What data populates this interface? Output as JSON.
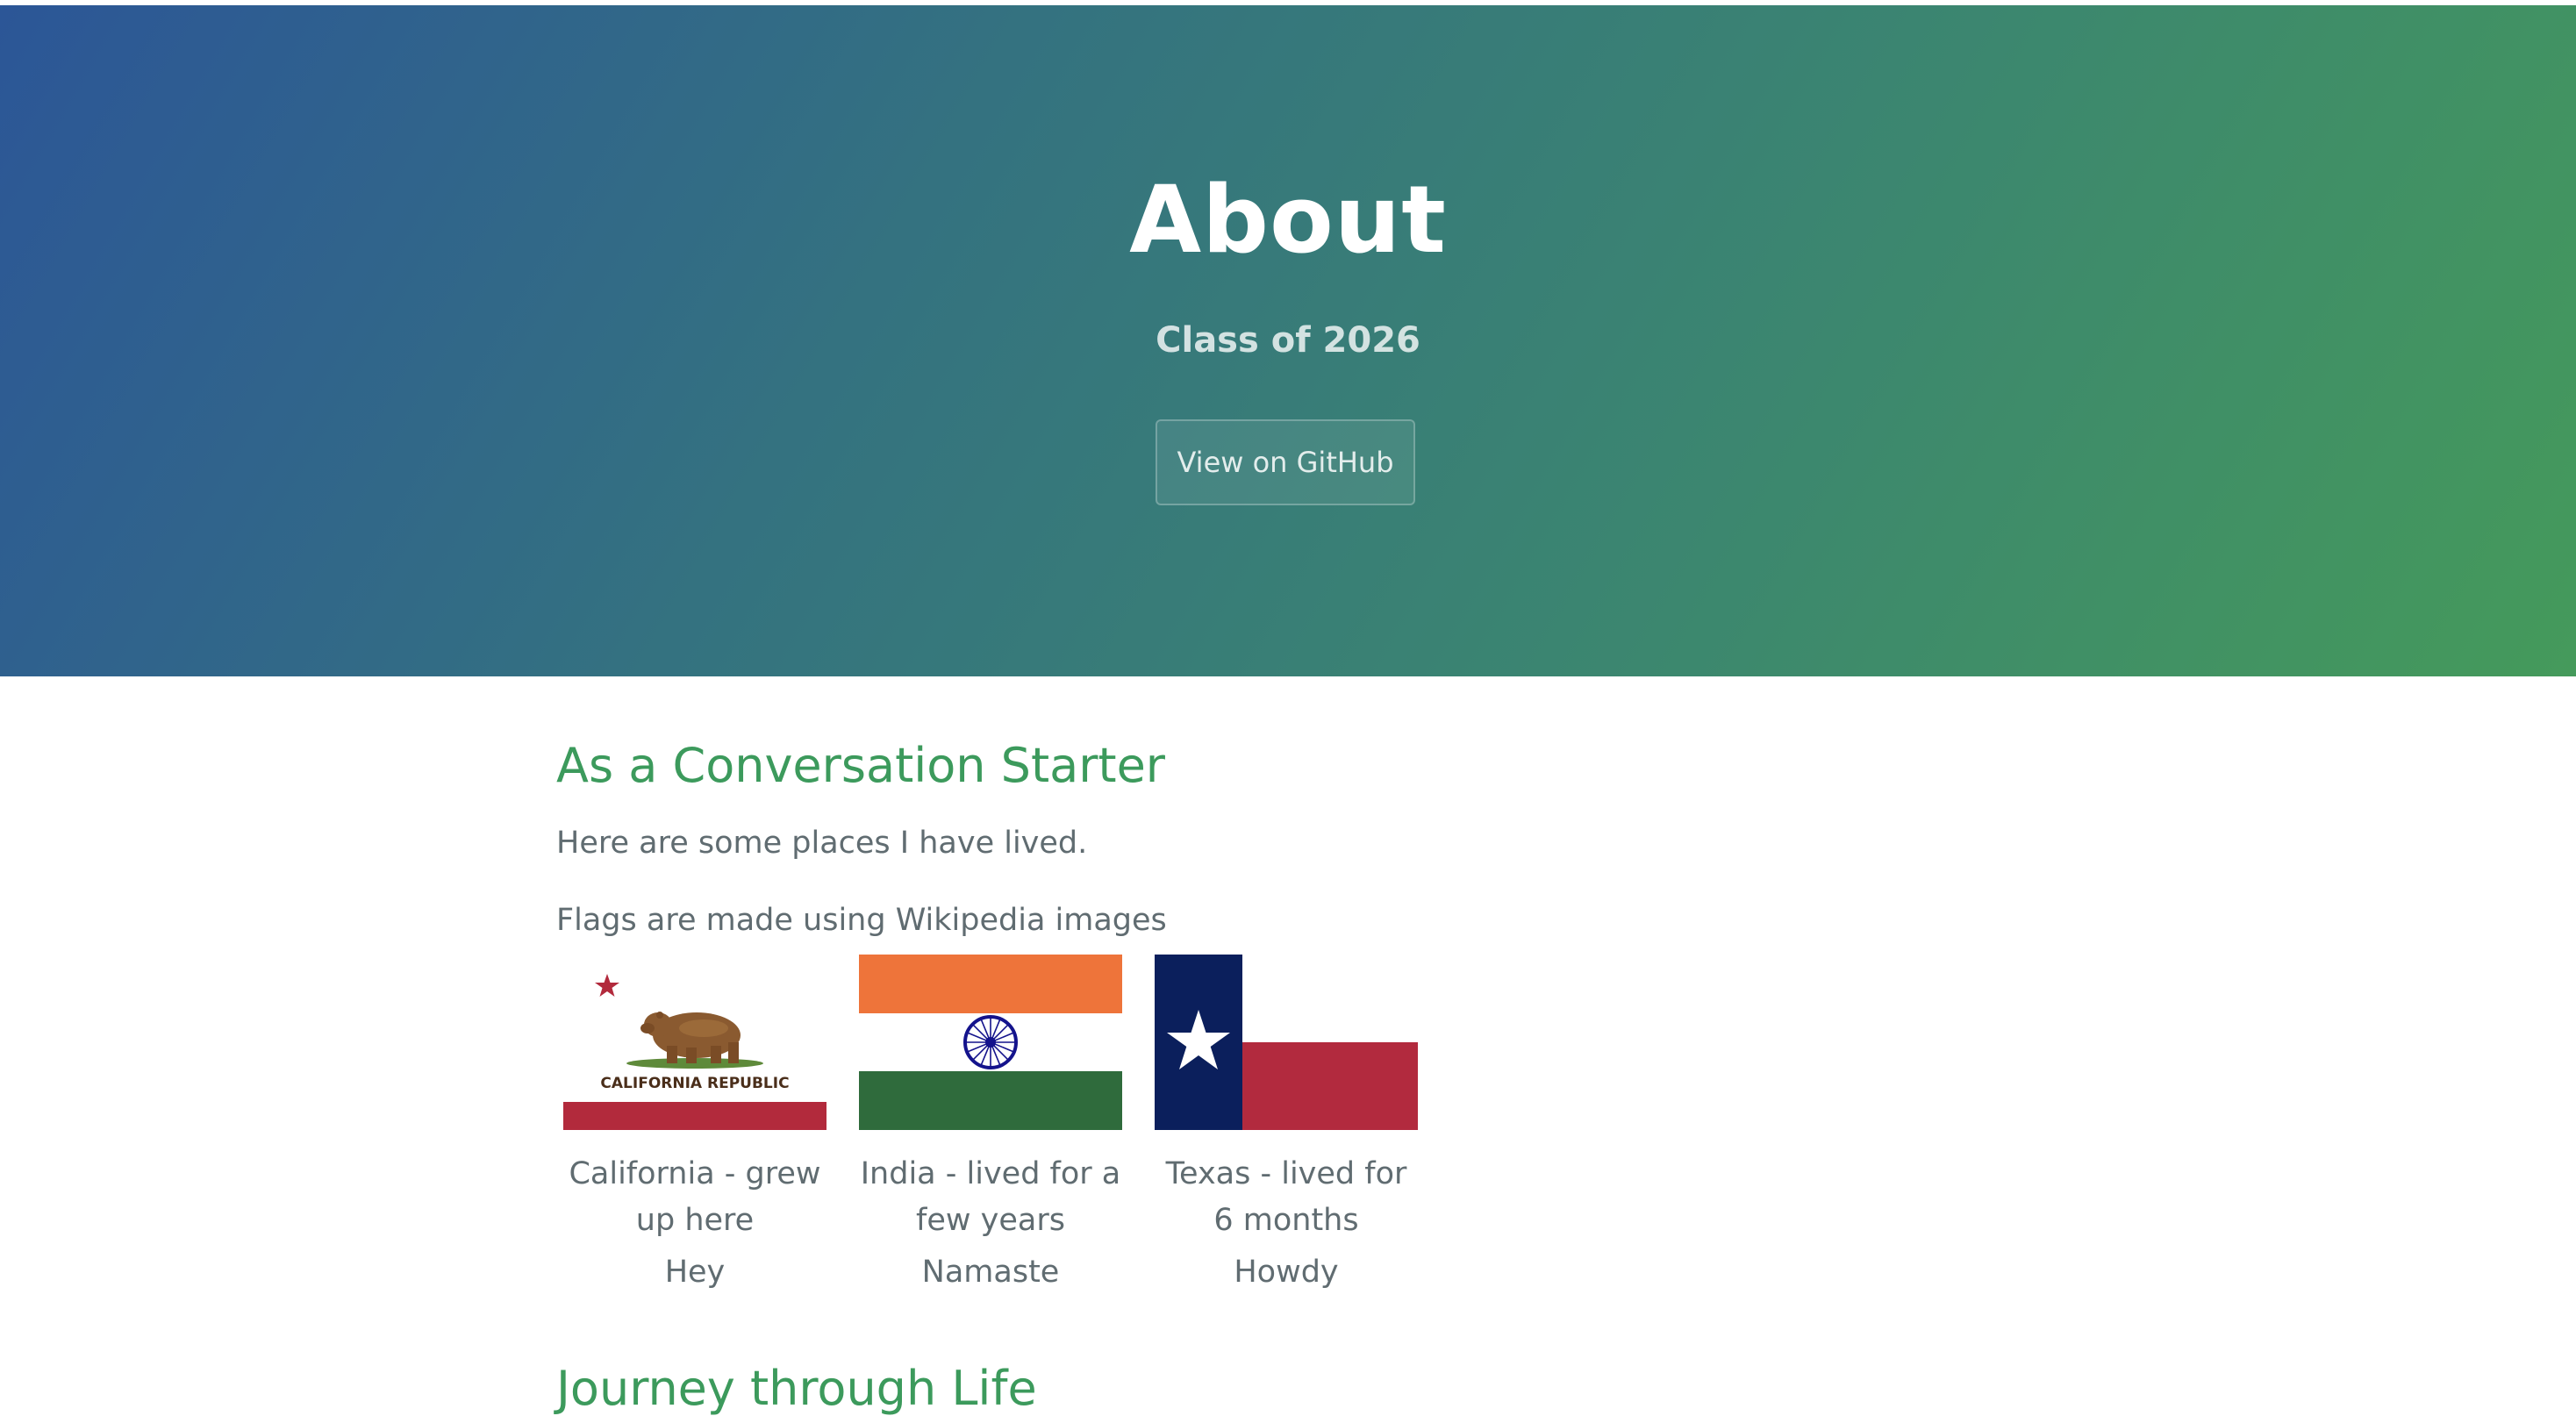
{
  "hero": {
    "title": "About",
    "tagline": "Class of 2026",
    "github_button_label": "View on GitHub"
  },
  "section_conversation": {
    "heading": "As a Conversation Starter",
    "intro": "Here are some places I have lived.",
    "flags_note": "Flags are made using Wikipedia images",
    "flags": [
      {
        "caption": "California - grew up here",
        "greeting": "Hey",
        "flag_text": "CALIFORNIA  REPUBLIC",
        "icon": "california-flag-icon"
      },
      {
        "caption": "India - lived for a few years",
        "greeting": "Namaste",
        "icon": "india-flag-icon"
      },
      {
        "caption": "Texas - lived for 6 months",
        "greeting": "Howdy",
        "icon": "texas-flag-icon"
      }
    ]
  },
  "section_journey": {
    "heading": "Journey through Life"
  },
  "colors": {
    "hero_gradient_start": "#2c5697",
    "hero_gradient_end": "#459a5b",
    "heading_green": "#3c9a5c",
    "body_text": "#606c71"
  }
}
